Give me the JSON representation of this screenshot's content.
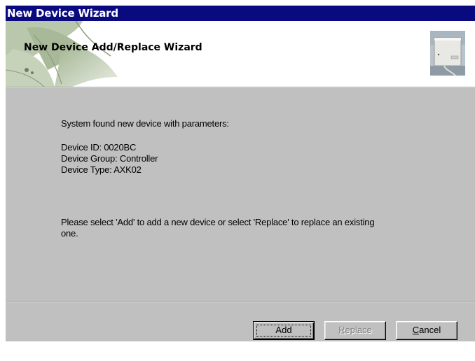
{
  "window": {
    "title": "New Device Wizard"
  },
  "header": {
    "title": "New Device Add/Replace Wizard",
    "image_icon": "device-image-icon"
  },
  "body": {
    "found_text": "System found new device with parameters:",
    "device_id": "Device ID: 0020BC",
    "device_group": "Device Group: Controller",
    "device_type": "Device Type: AXK02",
    "instruction_line1": "Please select 'Add' to add a new device or select 'Replace' to replace an existing",
    "instruction_line2": "one."
  },
  "buttons": {
    "add_label": "Add",
    "replace_first": "R",
    "replace_rest": "eplace",
    "cancel_first": "C",
    "cancel_rest": "ancel"
  },
  "colors": {
    "titlebar": "#0a0a80",
    "dialog_face": "#c0c0c0",
    "header_bg": "#ffffff",
    "disabled_text": "#808080"
  }
}
